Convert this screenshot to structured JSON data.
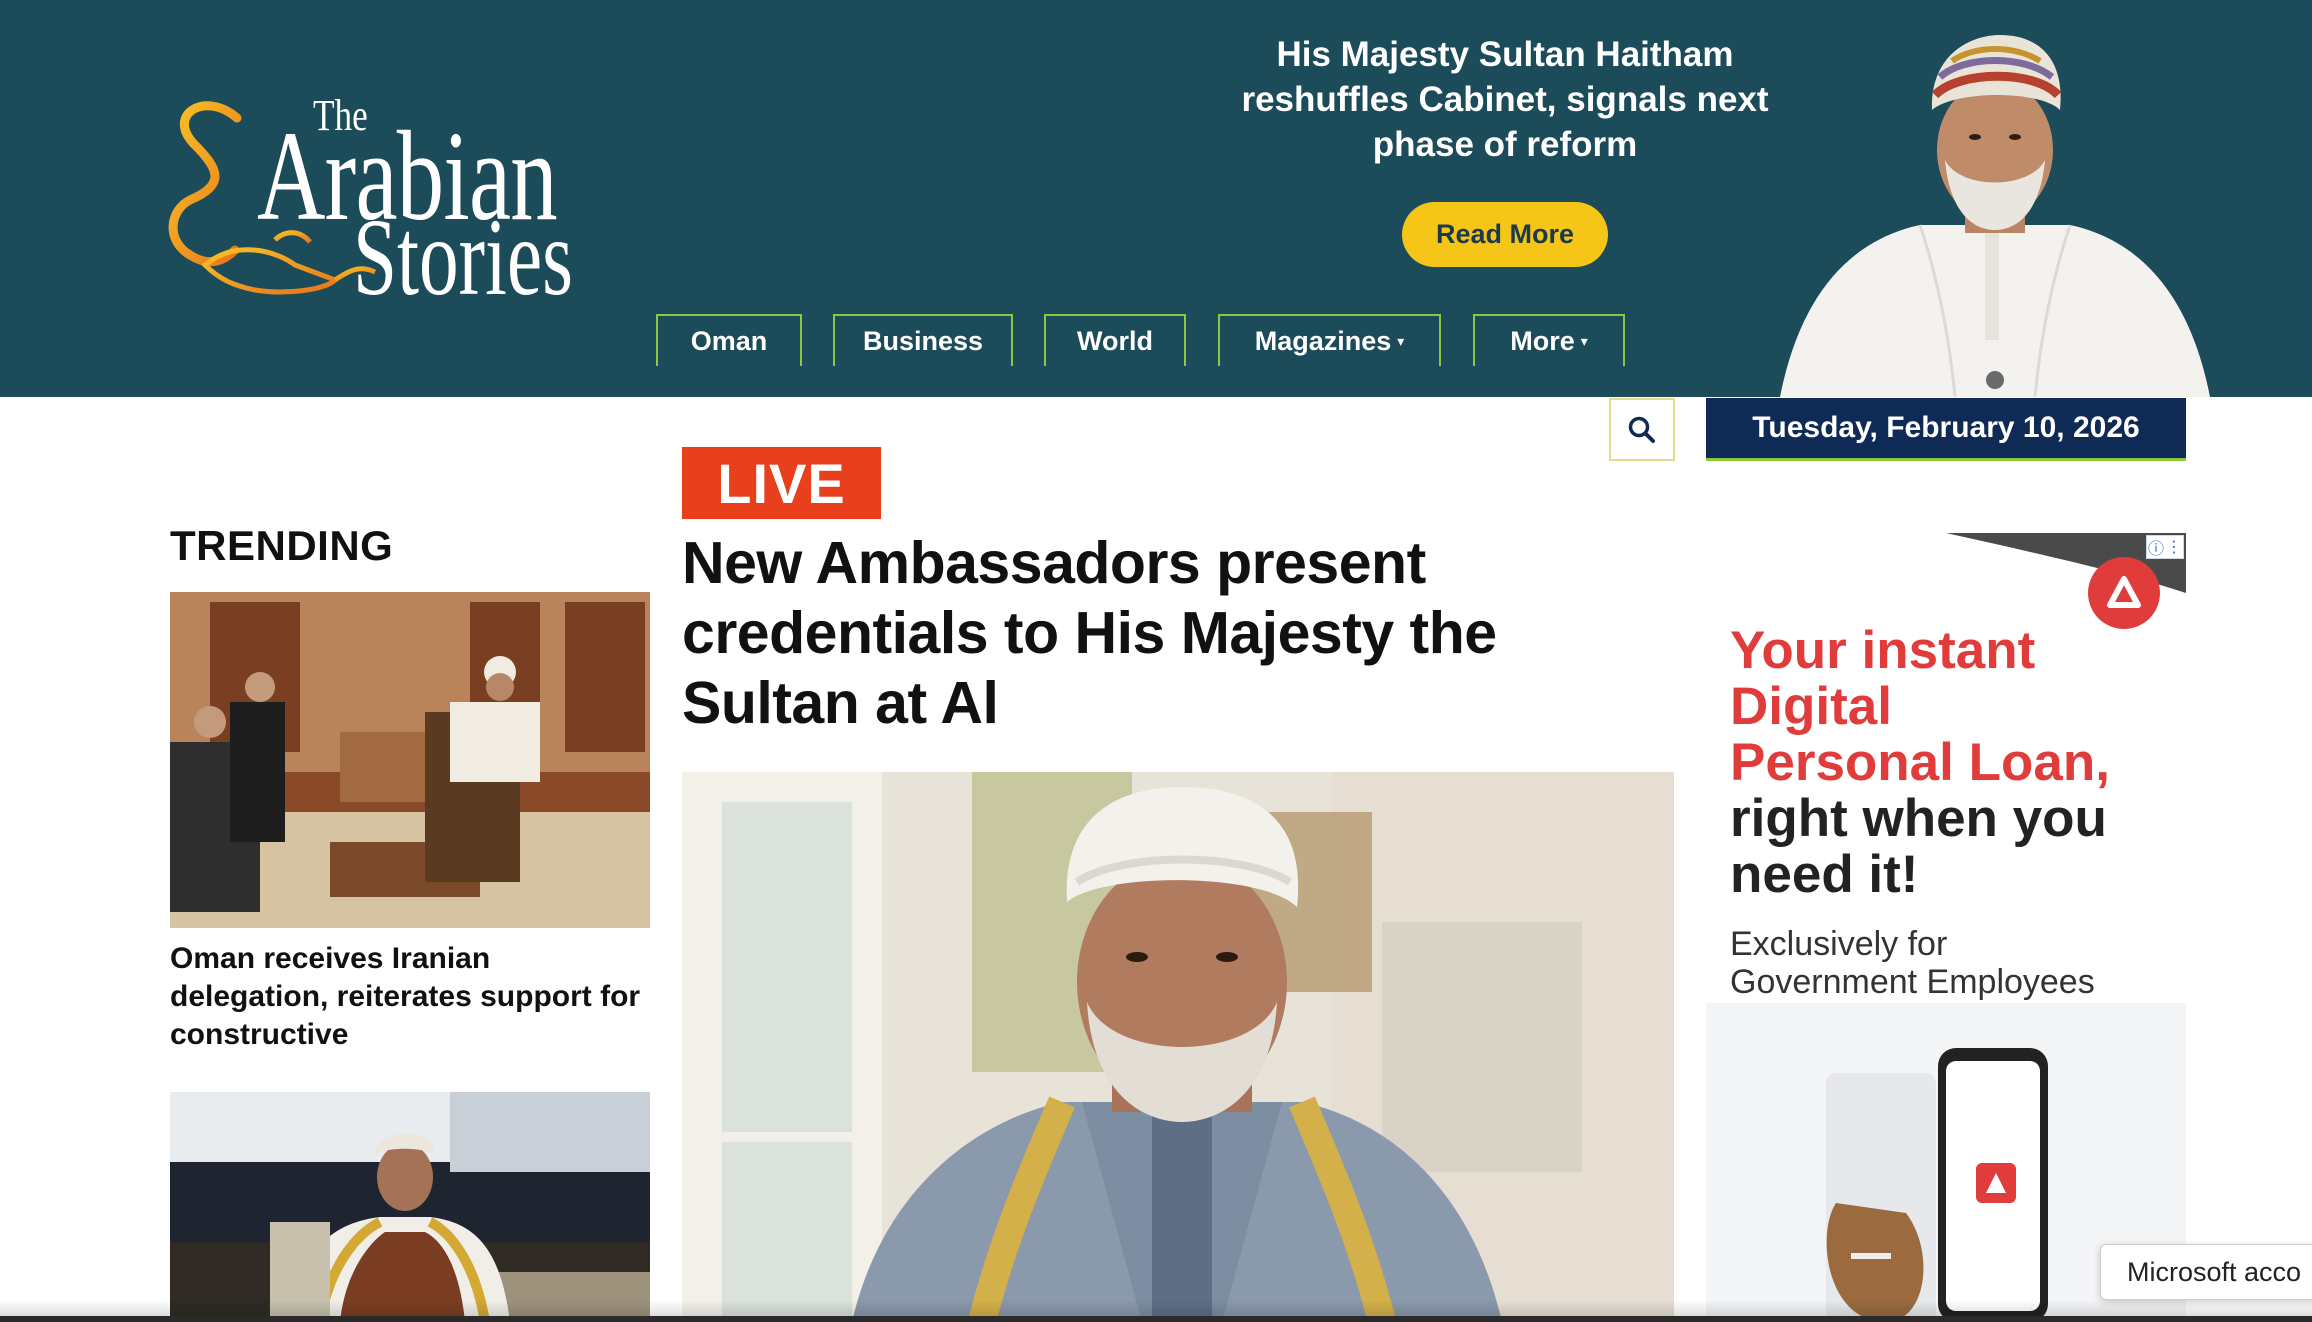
{
  "header": {
    "logo": {
      "the": "The",
      "arabian": "Arabian",
      "stories": "Stories"
    },
    "promo": {
      "headline": "His Majesty Sultan Haitham reshuffles Cabinet, signals next phase of reform",
      "button_label": "Read More"
    },
    "nav": [
      {
        "label": "Oman",
        "has_dropdown": false
      },
      {
        "label": "Business",
        "has_dropdown": false
      },
      {
        "label": "World",
        "has_dropdown": false
      },
      {
        "label": "Magazines",
        "has_dropdown": true
      },
      {
        "label": "More",
        "has_dropdown": true
      }
    ],
    "caret": "▾"
  },
  "topbar": {
    "search_icon": "search-icon",
    "date": "Tuesday, February 10, 2026"
  },
  "trending": {
    "title": "TRENDING",
    "items": [
      {
        "headline": "Oman receives Iranian delegation, reiterates support for constructive"
      }
    ]
  },
  "main_story": {
    "badge": "LIVE",
    "headline": "New Ambassadors present credentials to His Majesty the Sultan at Al"
  },
  "ad": {
    "line1": "Your instant",
    "line2": "Digital",
    "line3": "Personal Loan,",
    "line4": "right when you",
    "line5": "need it!",
    "sub1": "Exclusively for",
    "sub2": "Government Employees",
    "info_icon": "ⓘ",
    "menu_icon": "⋮"
  },
  "toast": {
    "text": "Microsoft acco"
  },
  "colors": {
    "header_bg": "#1c4b59",
    "nav_border": "#8dc63f",
    "button_yellow": "#f5c518",
    "live_red": "#e8401c",
    "date_bg": "#0f2a55",
    "ad_red": "#e03c3c"
  }
}
